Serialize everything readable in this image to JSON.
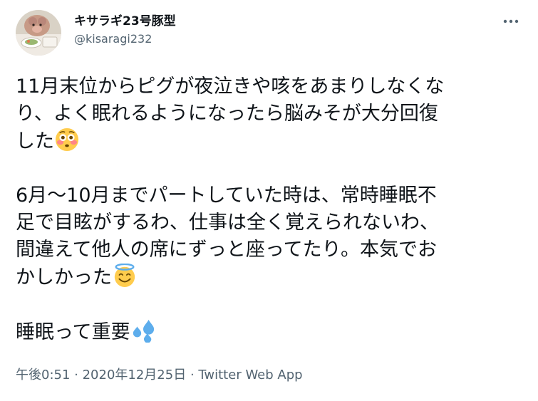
{
  "author": {
    "display_name": "キサラギ23号豚型",
    "handle": "@kisaragi232"
  },
  "tweet": {
    "paragraphs": [
      [
        "11月末位からピグが夜泣きや咳をあまりしなくな",
        "り、よく眠れるようになったら脳みそが大分回復",
        "した"
      ],
      [
        "6月～10月までパートしていた時は、常時睡眠不",
        "足で目眩がするわ、仕事は全く覚えられないわ、",
        "間違えて他人の席にずっと座ってたり。本気でお",
        "かしかった"
      ],
      [
        "睡眠って重要"
      ]
    ]
  },
  "meta": {
    "time": "午後0:51",
    "separator": " · ",
    "date": "2020年12月25日",
    "source": "Twitter Web App"
  },
  "icons": {
    "more": "more-horizontal-icon",
    "emoji_1": "flushed-face-emoji",
    "emoji_2": "smiling-face-with-halo-emoji",
    "emoji_3": "sweat-droplets-emoji"
  },
  "colors": {
    "text": "#0f1419",
    "secondary": "#536471",
    "emoji_yellow": "#ffcc4d",
    "emoji_blush": "#ff7892",
    "halo_blue": "#5dadec",
    "droplet_blue": "#5dadec"
  }
}
